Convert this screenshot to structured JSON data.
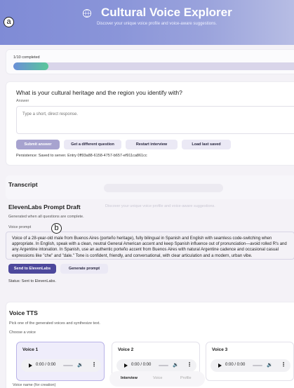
{
  "app": {
    "title": "Cultural Voice Explorer",
    "subtitle": "Discover your unique voice profile and voice-aware suggestions."
  },
  "markers": {
    "a": "a",
    "b": "b"
  },
  "progress": {
    "label": "1/10 completed",
    "fraction": 0.1
  },
  "question": {
    "title": "What is your cultural heritage and the region you identify with?",
    "answer_label": "Answer",
    "answer_placeholder": "Type a short, direct response.",
    "buttons": {
      "submit": "Submit answer",
      "different": "Get a different question",
      "restart": "Restart interview",
      "load": "Load last saved"
    },
    "persistence": "Persistence: Saved to server. Entry 0ff93a88-6158-4757-b657-ef911ca861cc"
  },
  "transcript": {
    "title": "Transcript"
  },
  "draft": {
    "title": "ElevenLabs Prompt Draft",
    "ghost_subtitle": "Discover your unique voice profile and voice-aware suggestions.",
    "note": "Generated when all questions are complete.",
    "voice_prompt_label": "Voice prompt",
    "voice_prompt": "Voice of a 28-year-old male from Buenos Aires (porteño heritage), fully bilingual in Spanish and English with seamless code-switching when appropriate. In English, speak with a clean, neutral General American accent and keep Spanish influence out of pronunciation—avoid rolled R's and any Argentine intonation. In Spanish, use an authentic porteño accent from Buenos Aires with natural Argentine cadence and occasional casual expressions like \"che\" and \"dale.\" Tone is confident, friendly, and conversational, with clear articulation and a modern, urban vibe.",
    "buttons": {
      "send": "Send to ElevenLabs",
      "generate": "Generate prompt"
    },
    "status": "Status: Sent to ElevenLabs."
  },
  "tts": {
    "title": "Voice TTS",
    "note": "Pick one of the generated voices and synthesize text.",
    "choose_label": "Choose a voice",
    "voices": [
      {
        "name": "Voice 1",
        "time": "0:00 / 0:00",
        "selected": true
      },
      {
        "name": "Voice 2",
        "time": "0:00 / 0:00",
        "selected": false
      },
      {
        "name": "Voice 3",
        "time": "0:00 / 0:00",
        "selected": false
      }
    ],
    "voice_name_label": "Voice name (for creation)"
  },
  "nav": {
    "items": [
      "Interview",
      "Voice",
      "Profile"
    ],
    "active": "Interview"
  },
  "colors": {
    "accent": "#4d489c",
    "hero": "#8a95d9",
    "progress_start": "#6a8fd8",
    "progress_end": "#5ac79a"
  }
}
